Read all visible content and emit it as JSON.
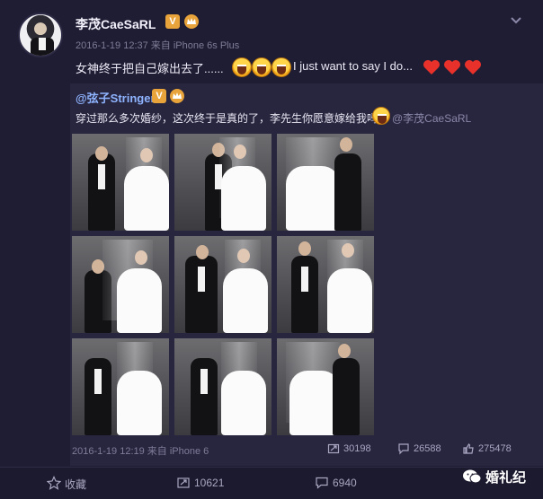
{
  "post": {
    "username": "李茂CaeSaRL",
    "verified_badge": "V",
    "meta": "2016-1-19 12:37 来自 iPhone 6s Plus",
    "text": "女神终于把自己嫁出去了......",
    "text_after": "I just want to say I do...",
    "icons": [
      "laugh-emoji",
      "heart-emoji",
      "chevron-down"
    ]
  },
  "repost": {
    "username": "@弦子Stringer",
    "verified_badge": "V",
    "text": "穿过那么多次婚纱，这次终于是真的了，李先生你愿意嫁给我吗",
    "mention": "@李茂CaeSaRL",
    "meta": "2016-1-19 12:19 来自 iPhone 6",
    "reposts": "30198",
    "comments": "26588",
    "likes": "275478"
  },
  "actions": {
    "favorite": "收藏",
    "repost_count": "10621",
    "comment_count": "6940"
  },
  "watermark": "婚礼纪",
  "colors": {
    "background": "#1f1d33",
    "repost_bg": "#28263f",
    "link": "#8fb4ff",
    "heart": "#e8312a"
  }
}
